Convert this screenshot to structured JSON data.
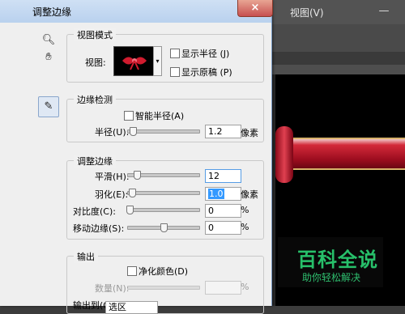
{
  "ps": {
    "logo": "Ps",
    "menu_view": "视图(V)",
    "minimize": "—"
  },
  "dialog": {
    "title": "调整边缘",
    "close": "×",
    "view_mode": {
      "title": "视图模式",
      "view_label": "视图:",
      "show_radius": "显示半径 (J)",
      "show_original": "显示原稿 (P)"
    },
    "edge_detection": {
      "title": "边缘检测",
      "smart_radius": "智能半径(A)",
      "radius_label": "半径(U):",
      "radius_value": "1.2",
      "radius_unit": "像素",
      "radius_level": 0.02
    },
    "adjust_edge": {
      "title": "调整边缘",
      "smooth_label": "平滑(H):",
      "smooth_value": "12",
      "feather_label": "羽化(E):",
      "feather_value": "1.0",
      "feather_unit": "像素",
      "contrast_label": "对比度(C):",
      "contrast_value": "0",
      "contrast_unit": "%",
      "shift_label": "移动边缘(S):",
      "shift_value": "0",
      "shift_unit": "%"
    },
    "output": {
      "title": "输出",
      "decontaminate": "净化颜色(D)",
      "amount_label": "数量(N):",
      "amount_unit": "%",
      "output_to_label": "输出到(O):",
      "output_to_value": "选区"
    }
  },
  "watermark": {
    "title": "百科全说",
    "subtitle": "助你轻松解决"
  }
}
